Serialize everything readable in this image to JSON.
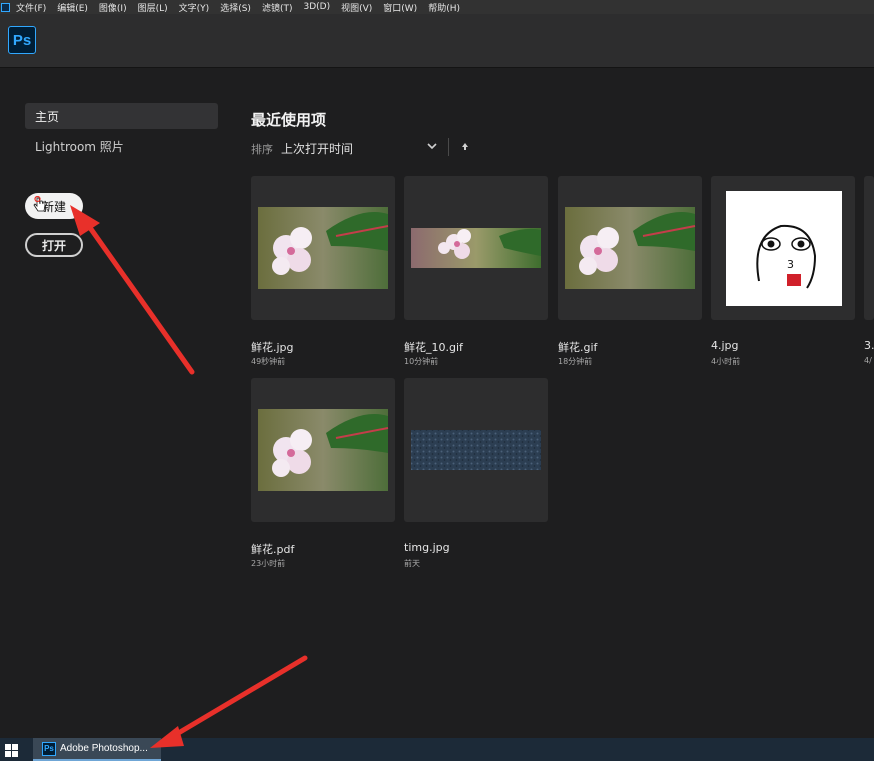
{
  "menubar": {
    "items": [
      "文件(F)",
      "编辑(E)",
      "图像(I)",
      "图层(L)",
      "文字(Y)",
      "选择(S)",
      "滤镜(T)",
      "3D(D)",
      "视图(V)",
      "窗口(W)",
      "帮助(H)"
    ]
  },
  "header": {
    "logo": "Ps"
  },
  "sidebar": {
    "home": "主页",
    "lightroom": "Lightroom 照片",
    "new_button": "新建",
    "open_button": "打开"
  },
  "main": {
    "title": "最近使用项",
    "sort_label": "排序",
    "sort_value": "上次打开时间",
    "files": [
      {
        "name": "鲜花.jpg",
        "time": "49秒钟前"
      },
      {
        "name": "鲜花_10.gif",
        "time": "10分钟前"
      },
      {
        "name": "鲜花.gif",
        "time": "18分钟前"
      },
      {
        "name": "4.jpg",
        "time": "4小时前"
      },
      {
        "name": "3.j",
        "time": "4/"
      },
      {
        "name": "鲜花.pdf",
        "time": "23小时前"
      },
      {
        "name": "timg.jpg",
        "time": "前天"
      }
    ]
  },
  "taskbar": {
    "app_label": "Adobe Photoshop..."
  },
  "colors": {
    "accent": "#31a8ff",
    "annotation_arrow": "#e8302a",
    "background": "#1e1e1f"
  }
}
